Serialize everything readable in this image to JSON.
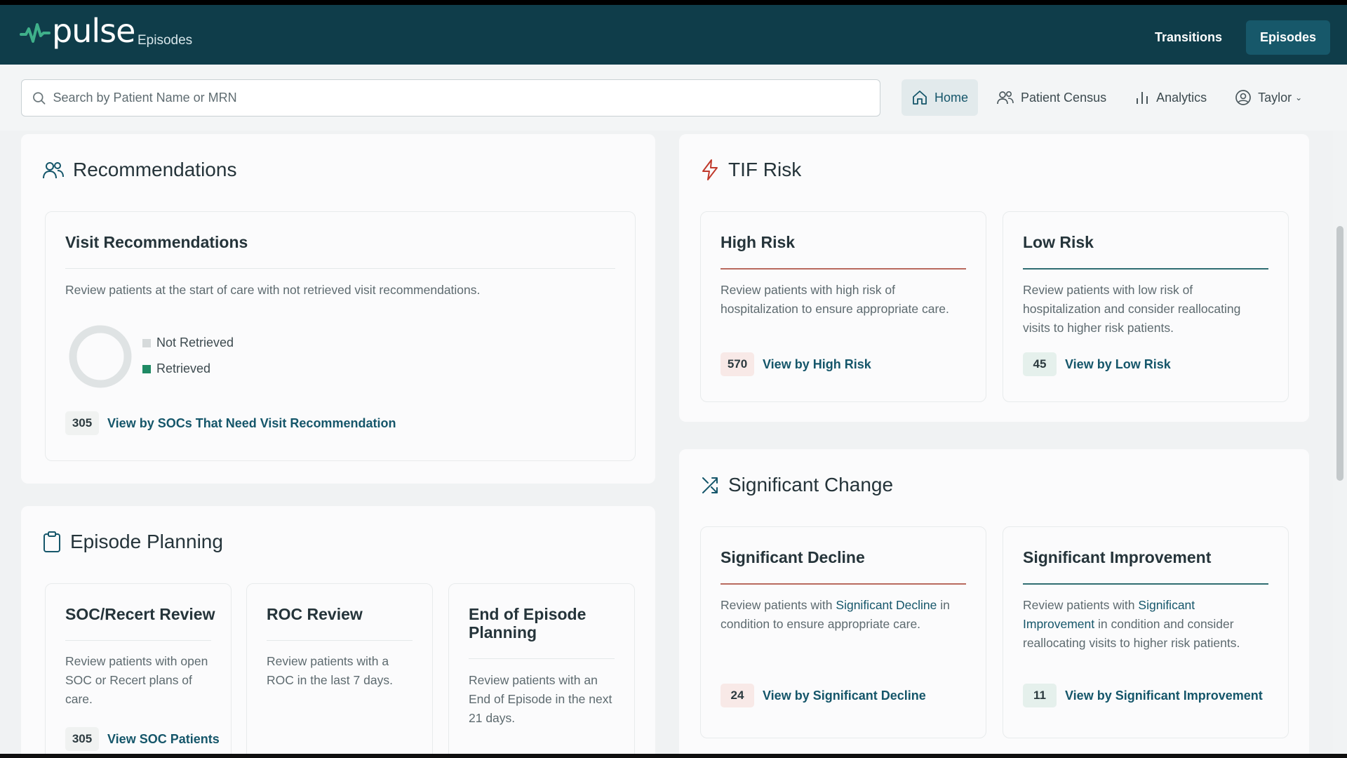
{
  "app": {
    "logo_text": "pulse",
    "logo_subtitle": "Episodes"
  },
  "topnav": [
    {
      "label": "Transitions",
      "active": false
    },
    {
      "label": "Episodes",
      "active": true
    }
  ],
  "search": {
    "placeholder": "Search by Patient Name or MRN",
    "value": ""
  },
  "subnav": [
    {
      "label": "Home",
      "icon": "home-icon",
      "active": true
    },
    {
      "label": "Patient Census",
      "icon": "users-icon",
      "active": false
    },
    {
      "label": "Analytics",
      "icon": "bar-chart-icon",
      "active": false
    },
    {
      "label": "Taylor",
      "icon": "user-circle-icon",
      "active": false,
      "has_dropdown": true
    }
  ],
  "recommendations": {
    "title": "Recommendations",
    "card": {
      "title": "Visit Recommendations",
      "description": "Review patients at the start of care with not retrieved visit recommendations.",
      "legend": [
        {
          "label": "Not Retrieved",
          "color": "#d6dadb"
        },
        {
          "label": "Retrieved",
          "color": "#1f8a64"
        }
      ],
      "count": "305",
      "link": "View by SOCs That Need Visit Recommendation"
    }
  },
  "episode_planning": {
    "title": "Episode Planning",
    "cards": [
      {
        "title": "SOC/Recert Review",
        "description": "Review patients with open SOC or Recert plans of care.",
        "count": "305",
        "link": "View SOC Patients"
      },
      {
        "title": "ROC Review",
        "description": "Review patients with a ROC in the last 7 days."
      },
      {
        "title": "End of Episode Planning",
        "description": "Review patients with an End of Episode in the next 21 days."
      }
    ]
  },
  "tif_risk": {
    "title": "TIF Risk",
    "cards": [
      {
        "title": "High Risk",
        "description": "Review patients with high risk of hospitalization to ensure appropriate care.",
        "count": "570",
        "link": "View by High Risk"
      },
      {
        "title": "Low Risk",
        "description": "Review patients with low risk of hospitalization and consider reallocating visits to higher risk patients.",
        "count": "45",
        "link": "View by Low Risk"
      }
    ]
  },
  "significant_change": {
    "title": "Significant Change",
    "cards": [
      {
        "title": "Significant Decline",
        "desc_before": "Review patients with",
        "desc_link": "Significant Decline",
        "desc_after": "in condition to ensure appropriate care.",
        "count": "24",
        "link": "View by Significant Decline"
      },
      {
        "title": "Significant Improvement",
        "desc_before": "Review patients with",
        "desc_link": "Significant Improvement",
        "desc_after": "in condition and consider reallocating visits to higher risk patients.",
        "count": "11",
        "link": "View by Significant Improvement"
      }
    ]
  },
  "colors": {
    "header_bg": "#0f3d4a",
    "accent": "#15566a",
    "risk_red": "#c0392b",
    "retrieved_green": "#1f8a64"
  }
}
